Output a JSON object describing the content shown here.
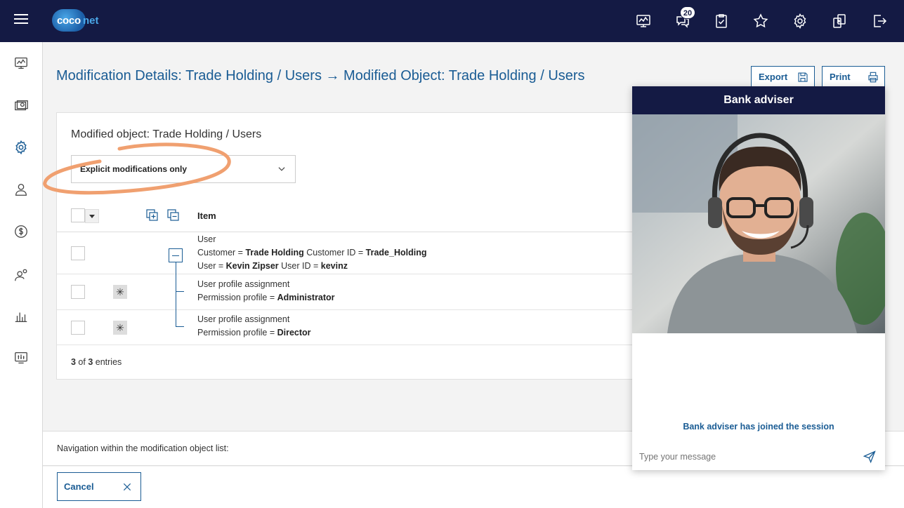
{
  "header": {
    "logo_part1": "coco",
    "logo_part2": "net",
    "notification_count": "20",
    "icons": [
      "dashboard-icon",
      "chat-icon",
      "tasks-icon",
      "star-icon",
      "settings-icon",
      "transfer-icon",
      "logout-icon"
    ]
  },
  "sidebar": {
    "icons": [
      "dashboard-icon",
      "accounts-icon",
      "settings-icon",
      "user-icon",
      "currency-icon",
      "user-settings-icon",
      "chart-icon",
      "monitor-icon"
    ]
  },
  "page": {
    "title": "Modification Details: Trade Holding / Users → Modified Object: Trade Holding / Users",
    "export_label": "Export",
    "print_label": "Print"
  },
  "card": {
    "subtitle": "Modified object: Trade Holding / Users",
    "filter_value": "Explicit modifications only",
    "column_item": "Item",
    "rows": [
      {
        "line1": "User",
        "line2_a": "Customer = ",
        "line2_b": "Trade Holding",
        "line2_c": " Customer ID = ",
        "line2_d": "Trade_Holding",
        "line3_a": "User = ",
        "line3_b": "Kevin Zipser",
        "line3_c": " User ID = ",
        "line3_d": "kevinz"
      },
      {
        "line1": "User profile assignment",
        "line2_a": "Permission profile = ",
        "line2_b": "Administrator"
      },
      {
        "line1": "User profile assignment",
        "line2_a": "Permission profile = ",
        "line2_b": "Director"
      }
    ],
    "count_shown": "3",
    "count_of": " of ",
    "count_total": "3",
    "count_suffix": " entries"
  },
  "footer": {
    "nav_text": "Navigation within the modification object list:",
    "cancel_label": "Cancel"
  },
  "chat": {
    "title": "Bank adviser",
    "status": "Bank adviser has joined the session",
    "input_placeholder": "Type your message"
  },
  "colors": {
    "topbar": "#141a44",
    "accent": "#1a5c94",
    "scribble": "#f0a070"
  }
}
